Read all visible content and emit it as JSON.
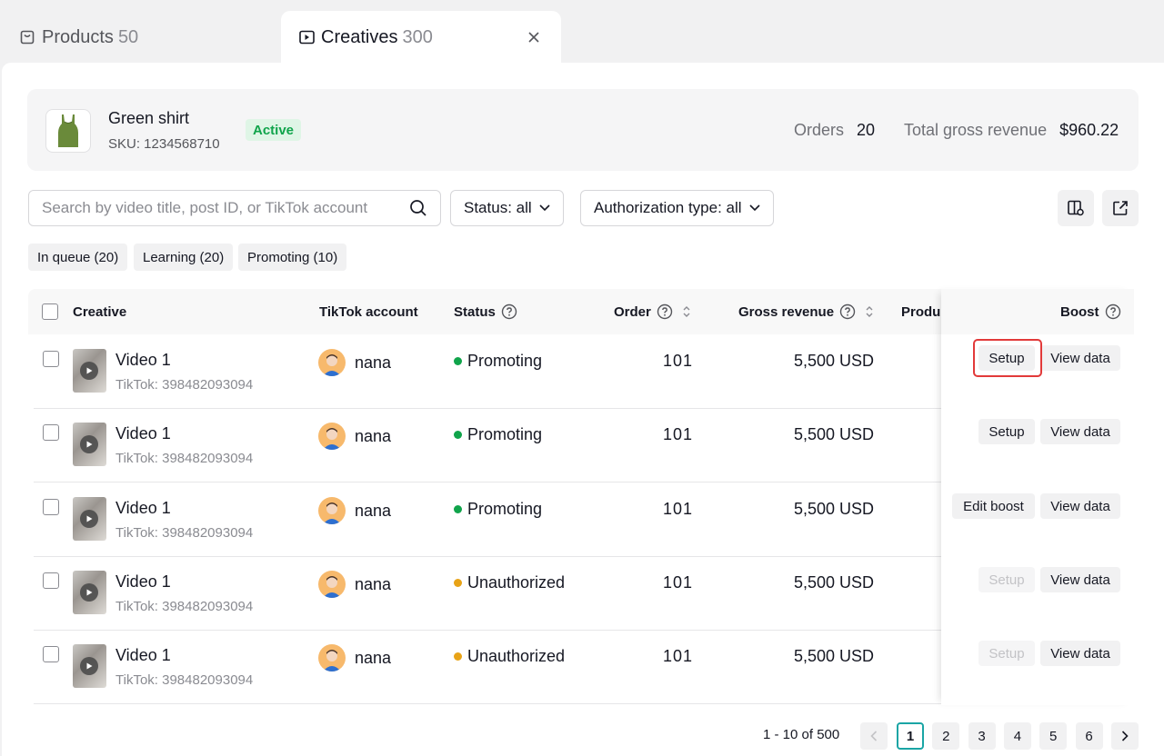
{
  "tabs": [
    {
      "label": "Products",
      "count": "50"
    },
    {
      "label": "Creatives",
      "count": "300"
    }
  ],
  "product": {
    "name": "Green shirt",
    "sku": "SKU: 1234568710",
    "status": "Active",
    "orders_label": "Orders",
    "orders_value": "20",
    "revenue_label": "Total gross revenue",
    "revenue_value": "$960.22"
  },
  "filters": {
    "search_placeholder": "Search by video title, post ID, or TikTok account",
    "status": "Status: all",
    "auth_type": "Authorization type: all"
  },
  "chips": [
    "In queue (20)",
    "Learning (20)",
    "Promoting (10)"
  ],
  "table": {
    "headers": {
      "creative": "Creative",
      "account": "TikTok account",
      "status": "Status",
      "order": "Order",
      "revenue": "Gross revenue",
      "product": "Produ",
      "boost": "Boost"
    },
    "rows": [
      {
        "title": "Video 1",
        "sub": "TikTok: 398482093094",
        "account": "nana",
        "status": "Promoting",
        "status_color": "#10a44b",
        "order": "101",
        "revenue": "5,500 USD",
        "action": "Setup",
        "action_disabled": false,
        "view": "View data"
      },
      {
        "title": "Video 1",
        "sub": "TikTok: 398482093094",
        "account": "nana",
        "status": "Promoting",
        "status_color": "#10a44b",
        "order": "101",
        "revenue": "5,500 USD",
        "action": "Setup",
        "action_disabled": false,
        "view": "View data"
      },
      {
        "title": "Video 1",
        "sub": "TikTok: 398482093094",
        "account": "nana",
        "status": "Promoting",
        "status_color": "#10a44b",
        "order": "101",
        "revenue": "5,500 USD",
        "action": "Edit boost",
        "action_disabled": false,
        "view": "View data"
      },
      {
        "title": "Video 1",
        "sub": "TikTok: 398482093094",
        "account": "nana",
        "status": "Unauthorized",
        "status_color": "#e8a317",
        "order": "101",
        "revenue": "5,500 USD",
        "action": "Setup",
        "action_disabled": true,
        "view": "View data"
      },
      {
        "title": "Video 1",
        "sub": "TikTok: 398482093094",
        "account": "nana",
        "status": "Unauthorized",
        "status_color": "#e8a317",
        "order": "101",
        "revenue": "5,500 USD",
        "action": "Setup",
        "action_disabled": true,
        "view": "View data"
      }
    ]
  },
  "pagination": {
    "info": "1 - 10 of 500",
    "pages": [
      "1",
      "2",
      "3",
      "4",
      "5",
      "6"
    ],
    "current": "1"
  },
  "colors": {
    "accent": "#1aa5a5",
    "active_badge": "#10a44b",
    "highlight": "#e23a3a"
  }
}
